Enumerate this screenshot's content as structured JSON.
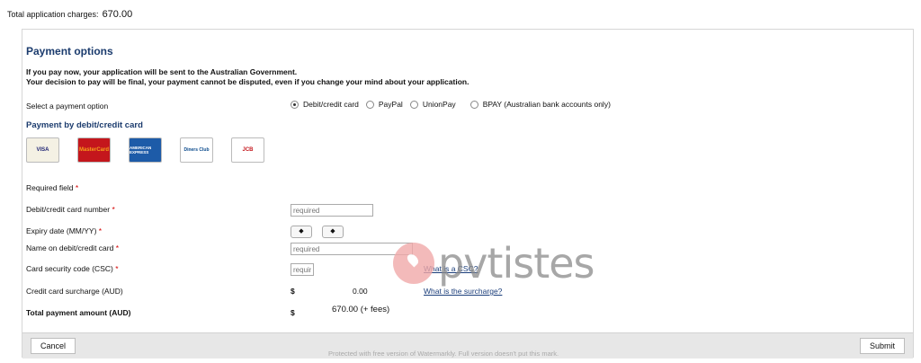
{
  "summary": {
    "label": "Total application charges:",
    "value": "670.00"
  },
  "payment": {
    "title": "Payment options",
    "notice_line1": "If you pay now, your application will be sent to the Australian Government.",
    "notice_line2": "Your decision to pay will be final, your payment cannot be disputed, even if you change your mind about your application.",
    "select_label": "Select a payment option",
    "options": [
      {
        "label": "Debit/credit card",
        "selected": true
      },
      {
        "label": "PayPal",
        "selected": false
      },
      {
        "label": "UnionPay",
        "selected": false
      },
      {
        "label": "BPAY (Australian bank accounts only)",
        "selected": false
      }
    ],
    "subtitle": "Payment by debit/credit card",
    "cards": [
      "VISA",
      "MasterCard",
      "AMERICAN EXPRESS",
      "Diners Club",
      "JCB"
    ]
  },
  "form": {
    "required_note": "Required field",
    "asterisk": "*",
    "card_number_label": "Debit/credit card number",
    "card_number_placeholder": "required",
    "expiry_label": "Expiry date (MM/YY)",
    "name_label": "Name on debit/credit card",
    "name_placeholder": "required",
    "csc_label": "Card security code (CSC)",
    "csc_placeholder": "required",
    "csc_help": "What is a CSC?",
    "surcharge_label": "Credit card surcharge (AUD)",
    "surcharge_currency": "$",
    "surcharge_value": "0.00",
    "surcharge_help": "What is the surcharge?",
    "total_label": "Total payment amount (AUD)",
    "total_currency": "$",
    "total_value": "670.00 (+ fees)"
  },
  "footer": {
    "cancel": "Cancel",
    "submit": "Submit"
  },
  "watermark": {
    "brand": "pvtistes",
    "note": "Protected with free version of Watermarkly. Full version doesn't put this mark."
  },
  "colors": {
    "heading": "#1c3c6e",
    "required": "#d40000",
    "link": "#1a3d7a",
    "footer": "#e7e7e7"
  }
}
